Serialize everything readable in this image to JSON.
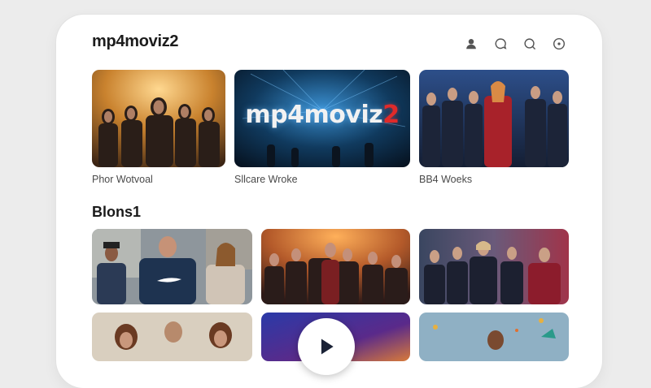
{
  "app": {
    "logo": "mp4moviz2"
  },
  "header_icons": [
    "user-icon",
    "chat-icon",
    "search-icon",
    "add-icon"
  ],
  "featured": [
    {
      "caption": "Phor Wotvoal"
    },
    {
      "caption": "Sllcare Wroke",
      "poster_text": "mp4moviz",
      "poster_accent": "2"
    },
    {
      "caption": "BB4 Woeks"
    }
  ],
  "section": {
    "title": "Blons1"
  },
  "play_button": {
    "icon": "play-icon"
  },
  "colors": {
    "accent": "#e02a2a",
    "background": "#ececec",
    "card_bg": "#ffffff"
  }
}
